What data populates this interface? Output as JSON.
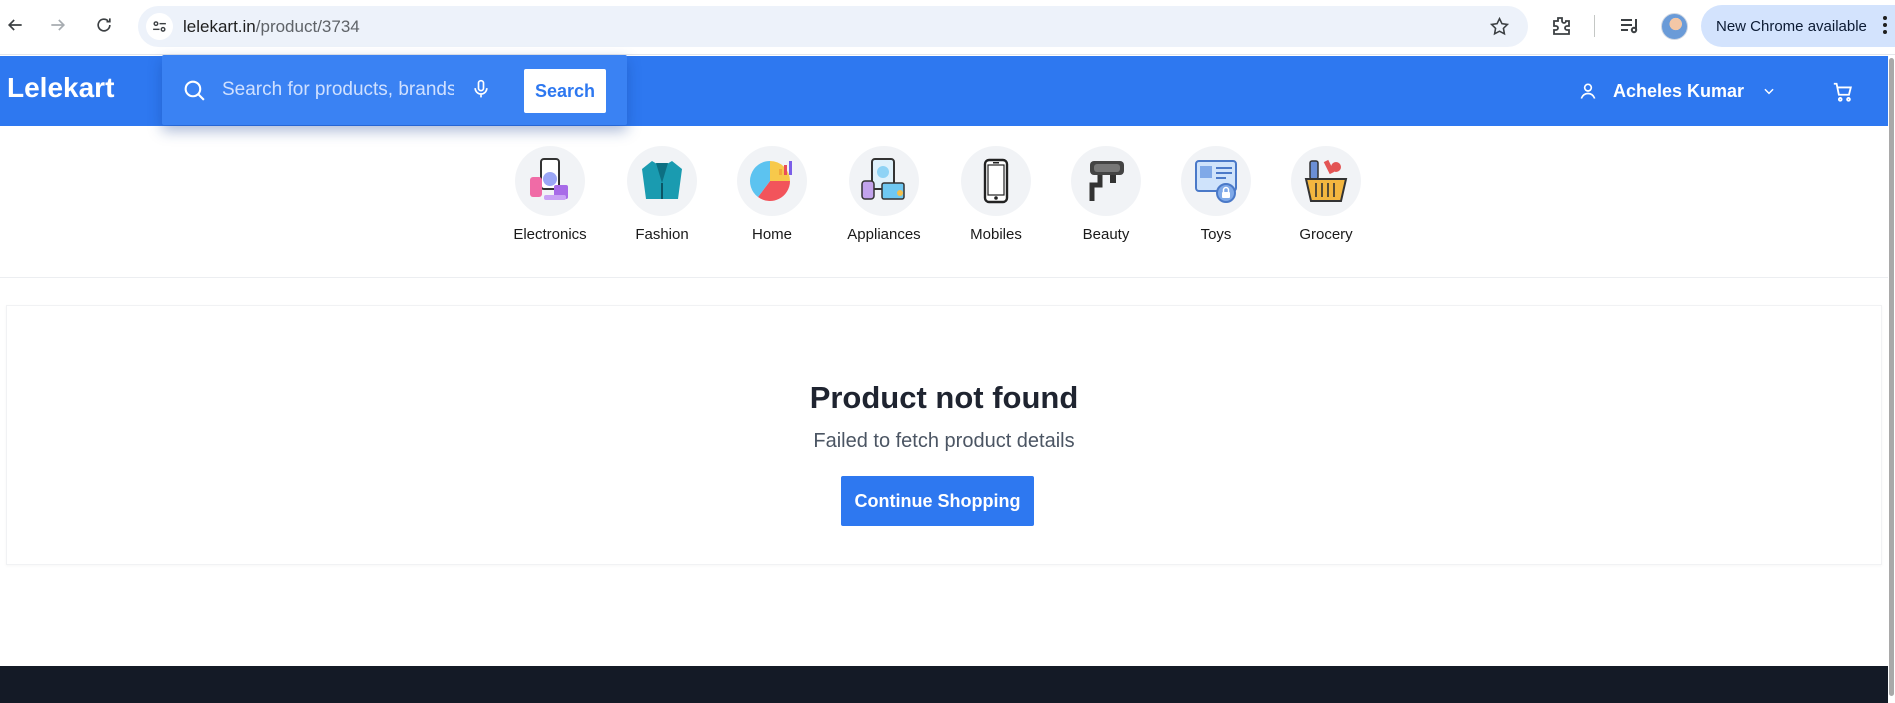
{
  "browser": {
    "url_host": "lelekart.in",
    "url_path": "/product/3734",
    "update_label": "New Chrome available"
  },
  "header": {
    "logo": "Lelekart",
    "search_placeholder": "Search for products, brands and more",
    "search_button": "Search",
    "account_name": "Acheles Kumar"
  },
  "categories": [
    {
      "label": "Electronics",
      "icon": "electronics-icon"
    },
    {
      "label": "Fashion",
      "icon": "fashion-icon"
    },
    {
      "label": "Home",
      "icon": "home-icon"
    },
    {
      "label": "Appliances",
      "icon": "appliances-icon"
    },
    {
      "label": "Mobiles",
      "icon": "mobiles-icon"
    },
    {
      "label": "Beauty",
      "icon": "beauty-icon"
    },
    {
      "label": "Toys",
      "icon": "toys-icon"
    },
    {
      "label": "Grocery",
      "icon": "grocery-icon"
    }
  ],
  "main": {
    "title": "Product not found",
    "message": "Failed to fetch product details",
    "button": "Continue Shopping"
  },
  "colors": {
    "brand": "#2e78f0",
    "footer": "#141a26"
  }
}
